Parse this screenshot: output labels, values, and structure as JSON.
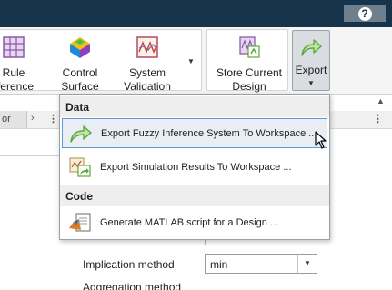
{
  "toolbar": {
    "help_label": "?",
    "buttons": [
      {
        "line1": "Rule",
        "line2": "Inference",
        "icon": "rule-inference-icon"
      },
      {
        "line1": "Control",
        "line2": "Surface",
        "icon": "control-surface-icon"
      },
      {
        "line1": "System",
        "line2": "Validation",
        "icon": "system-validation-icon"
      },
      {
        "line1": "Store Current",
        "line2": "Design",
        "icon": "store-design-icon"
      },
      {
        "line1": "Export",
        "line2": "",
        "icon": "export-arrow-icon"
      }
    ],
    "dropdown_glyph": "▼",
    "collapse_glyph": "▲"
  },
  "tab_strip": {
    "left_tab_text": "or",
    "chevron": "›",
    "menu_glyph": "⋮"
  },
  "export_menu": {
    "sections": [
      {
        "header": "Data",
        "items": [
          {
            "label": "Export Fuzzy Inference System To Workspace ...",
            "icon": "export-arrow-icon",
            "highlighted": true
          },
          {
            "label": "Export Simulation Results To Workspace ...",
            "icon": "simulation-results-icon",
            "highlighted": false
          }
        ]
      },
      {
        "header": "Code",
        "items": [
          {
            "label": "Generate MATLAB script for a Design ...",
            "icon": "matlab-script-icon",
            "highlighted": false
          }
        ]
      }
    ]
  },
  "form": {
    "implication_label": "Implication method",
    "implication_value": "min",
    "next_label": "Aggregation method"
  },
  "colors": {
    "title_band": "#17344d",
    "export_pressed": "#d9dde1",
    "menu_highlight_border": "#5d9bd8",
    "arrow_green": "#5aa83c"
  }
}
